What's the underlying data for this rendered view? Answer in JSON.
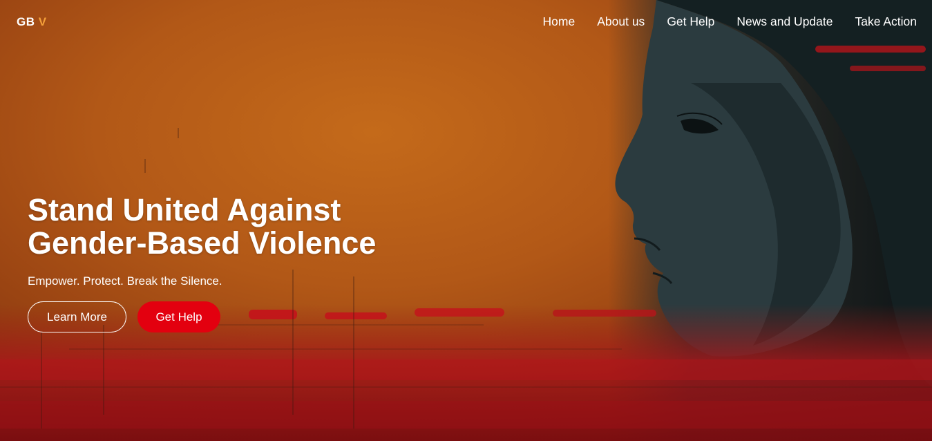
{
  "nav": {
    "logo_main": "GB",
    "logo_accent": "V",
    "links": [
      {
        "label": "Home"
      },
      {
        "label": "About us"
      },
      {
        "label": "Get Help"
      },
      {
        "label": "News and Update"
      },
      {
        "label": "Take Action"
      }
    ]
  },
  "hero": {
    "headline_line1": "Stand United Against",
    "headline_line2": "Gender-Based Violence",
    "tagline": "Empower. Protect. Break the Silence.",
    "learn_more_label": "Learn More",
    "get_help_label": "Get Help"
  },
  "colors": {
    "logo_accent": "#f4a03a",
    "primary_button": "#e3000f",
    "background_orange": "#b25817",
    "paint_red": "#c4121b"
  },
  "icons": {
    "hero_image": "woman-profile-illustration"
  }
}
